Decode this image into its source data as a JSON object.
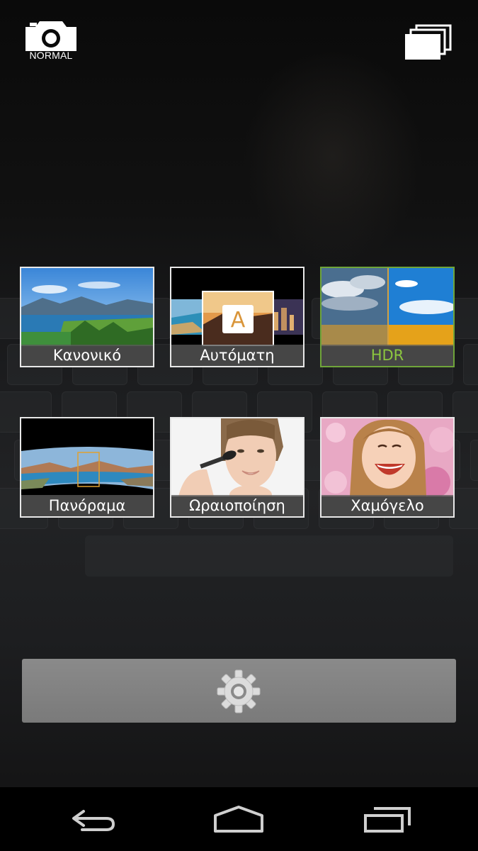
{
  "top_bar": {
    "camera_mode_label": "NORMAL",
    "camera_mode_icon": "camera-icon",
    "gallery_icon": "gallery-stack-icon"
  },
  "shooting_modes": [
    {
      "label": "Κανονικό",
      "thumbnail": "lake-landscape",
      "selected": false
    },
    {
      "label": "Αυτόματη",
      "thumbnail": "auto-scene-collage",
      "selected": false
    },
    {
      "label": "HDR",
      "thumbnail": "hdr-sky-field",
      "selected": true
    },
    {
      "label": "Πανόραμα",
      "thumbnail": "panorama-bay",
      "selected": false
    },
    {
      "label": "Ωραιοποίηση",
      "thumbnail": "beauty-face",
      "selected": false
    },
    {
      "label": "Χαμόγελο",
      "thumbnail": "smiling-child",
      "selected": false
    }
  ],
  "auto_badge_letter": "A",
  "settings": {
    "icon": "gear-icon"
  },
  "navigation": {
    "back_icon": "back-icon",
    "home_icon": "home-icon",
    "recents_icon": "recent-apps-icon"
  },
  "colors": {
    "selected_border": "#6fa53a",
    "selected_label": "#8cc63f",
    "tile_border": "#e8e8e8",
    "settings_bar": "#808080"
  }
}
